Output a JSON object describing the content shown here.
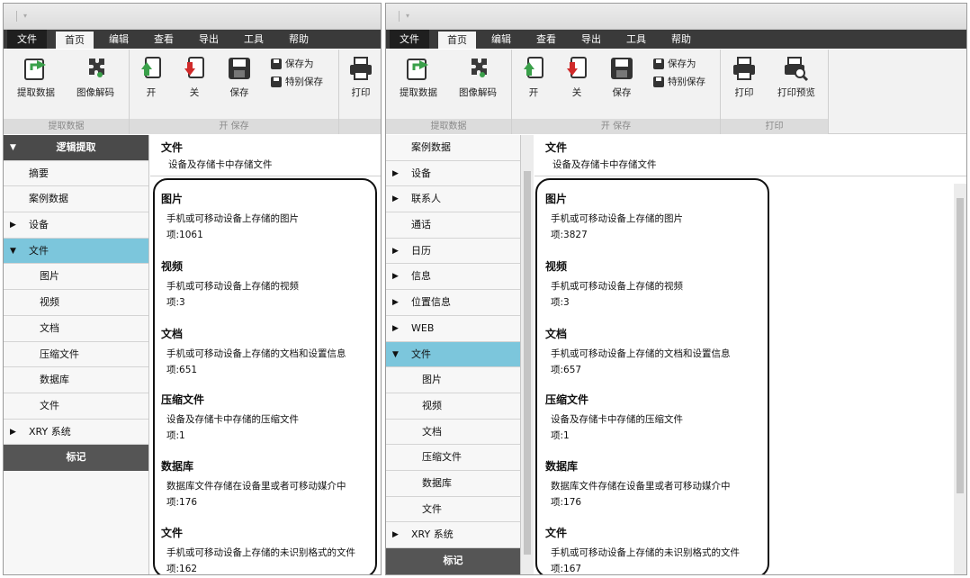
{
  "left": {
    "menu": [
      "文件",
      "首页",
      "编辑",
      "查看",
      "导出",
      "工具",
      "帮助"
    ],
    "ribbon": {
      "extract": "提取数据",
      "image_decode": "图像解码",
      "group_extract": "提取数据",
      "open": "开",
      "close": "关",
      "save": "保存",
      "save_as": "保存为",
      "special_save": "特别保存",
      "group_open_save": "开 保存",
      "print": "打印"
    },
    "nav": {
      "header": "逻辑提取",
      "items": [
        "摘要",
        "案例数据",
        "设备",
        "文件",
        "图片",
        "视频",
        "文档",
        "压缩文件",
        "数据库",
        "文件",
        "XRY 系统"
      ],
      "footer": "标记"
    },
    "content": {
      "title": "文件",
      "desc": "设备及存储卡中存储文件",
      "items": [
        {
          "title": "图片",
          "desc": "手机或可移动设备上存储的图片",
          "count": "项:1061"
        },
        {
          "title": "视频",
          "desc": "手机或可移动设备上存储的视频",
          "count": "项:3"
        },
        {
          "title": "文档",
          "desc": "手机或可移动设备上存储的文档和设置信息",
          "count": "项:651"
        },
        {
          "title": "压缩文件",
          "desc": "设备及存储卡中存储的压缩文件",
          "count": "项:1"
        },
        {
          "title": "数据库",
          "desc": "数据库文件存储在设备里或者可移动媒介中",
          "count": "项:176"
        },
        {
          "title": "文件",
          "desc": "手机或可移动设备上存储的未识别格式的文件",
          "count": "项:162"
        }
      ]
    }
  },
  "right": {
    "menu": [
      "文件",
      "首页",
      "编辑",
      "查看",
      "导出",
      "工具",
      "帮助"
    ],
    "ribbon": {
      "extract": "提取数据",
      "image_decode": "图像解码",
      "group_extract": "提取数据",
      "open": "开",
      "close": "关",
      "save": "保存",
      "save_as": "保存为",
      "special_save": "特别保存",
      "group_open_save": "开 保存",
      "print": "打印",
      "print_preview": "打印预览",
      "group_print": "打印"
    },
    "nav": {
      "items": [
        "案例数据",
        "设备",
        "联系人",
        "通话",
        "日历",
        "信息",
        "位置信息",
        "WEB",
        "文件",
        "图片",
        "视频",
        "文档",
        "压缩文件",
        "数据库",
        "文件",
        "XRY 系统"
      ],
      "footer": "标记"
    },
    "content": {
      "title": "文件",
      "desc": "设备及存储卡中存储文件",
      "items": [
        {
          "title": "图片",
          "desc": "手机或可移动设备上存储的图片",
          "count": "项:3827"
        },
        {
          "title": "视频",
          "desc": "手机或可移动设备上存储的视频",
          "count": "项:3"
        },
        {
          "title": "文档",
          "desc": "手机或可移动设备上存储的文档和设置信息",
          "count": "项:657"
        },
        {
          "title": "压缩文件",
          "desc": "设备及存储卡中存储的压缩文件",
          "count": "项:1"
        },
        {
          "title": "数据库",
          "desc": "数据库文件存储在设备里或者可移动媒介中",
          "count": "项:176"
        },
        {
          "title": "文件",
          "desc": "手机或可移动设备上存储的未识别格式的文件",
          "count": "项:167"
        }
      ]
    }
  },
  "colors": {
    "selected_row": "#7cc6dc",
    "menubar": "#3a3a3a",
    "nav_header": "#4a4a4a"
  }
}
